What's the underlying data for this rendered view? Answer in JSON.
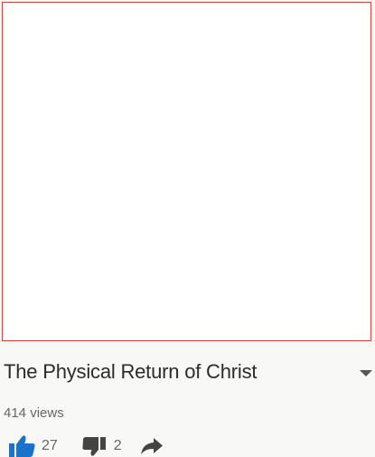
{
  "video": {
    "title": "The Physical Return of Christ",
    "views": "414 views"
  },
  "actions": {
    "like_count": "27",
    "dislike_count": "2"
  },
  "icons": {
    "like": "thumbs-up-icon",
    "dislike": "thumbs-down-icon",
    "share": "share-arrow-icon",
    "expand": "chevron-down-icon"
  },
  "colors": {
    "like_active": "#1a73c9",
    "frame_border": "#d8403a",
    "icon_dark": "#444444"
  }
}
